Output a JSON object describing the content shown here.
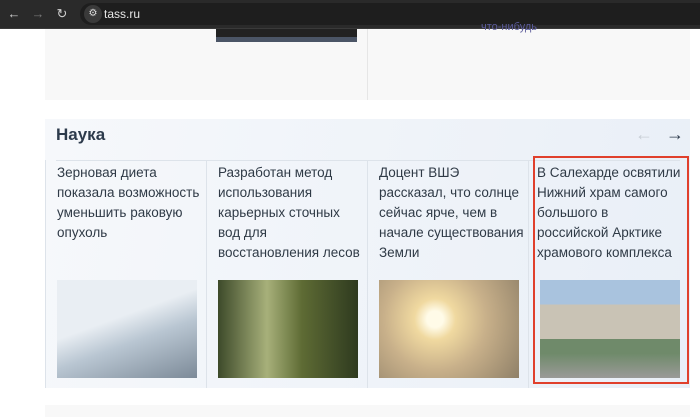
{
  "browser": {
    "url": "tass.ru",
    "back_icon": "arrow-left",
    "forward_icon": "arrow-right",
    "reload_icon": "reload",
    "site_settings_icon": "tune"
  },
  "prev_section": {
    "cut_text": "что-нибудь"
  },
  "science": {
    "title": "Наука",
    "cards": [
      {
        "title": "Зерновая диета показала возможность уменьшить раковую опухоль"
      },
      {
        "title": "Разработан метод использования карьерных сточных вод для восстановления лесов"
      },
      {
        "title": "Доцент ВШЭ рассказал, что солнце сейчас ярче, чем в начале существования Земли"
      },
      {
        "title": "В Салехарде освятили Нижний храм самого большого в российской Арктике храмового комплекса"
      }
    ]
  },
  "colors": {
    "highlight": "#e0402c",
    "title": "#2d3b4c"
  }
}
